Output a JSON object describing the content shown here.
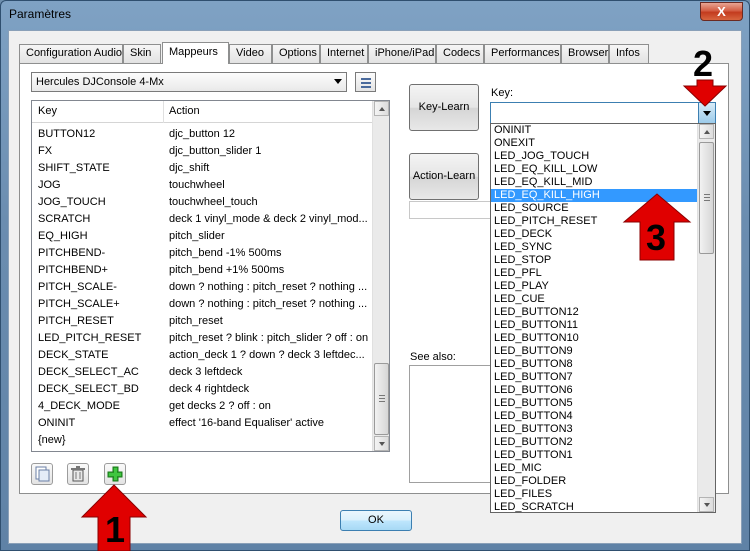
{
  "window": {
    "title": "Paramètres",
    "close_glyph": "X"
  },
  "tabs": [
    {
      "label": "Configuration Audio",
      "active": false
    },
    {
      "label": "Skin",
      "active": false
    },
    {
      "label": "Mappeurs",
      "active": true
    },
    {
      "label": "Video",
      "active": false
    },
    {
      "label": "Options",
      "active": false
    },
    {
      "label": "Internet",
      "active": false
    },
    {
      "label": "iPhone/iPad",
      "active": false
    },
    {
      "label": "Codecs",
      "active": false
    },
    {
      "label": "Performances",
      "active": false
    },
    {
      "label": "Browser",
      "active": false
    },
    {
      "label": "Infos",
      "active": false
    }
  ],
  "device": {
    "selected": "Hercules DJConsole 4-Mx",
    "list_icon": "list-icon"
  },
  "mapping_table": {
    "headers": {
      "key": "Key",
      "action": "Action"
    },
    "rows": [
      {
        "key": "BUTTON12",
        "action": "djc_button 12"
      },
      {
        "key": "FX",
        "action": "djc_button_slider 1"
      },
      {
        "key": "SHIFT_STATE",
        "action": "djc_shift"
      },
      {
        "key": "JOG",
        "action": "touchwheel"
      },
      {
        "key": "JOG_TOUCH",
        "action": "touchwheel_touch"
      },
      {
        "key": "SCRATCH",
        "action": "deck 1 vinyl_mode & deck 2 vinyl_mod..."
      },
      {
        "key": "EQ_HIGH",
        "action": "pitch_slider"
      },
      {
        "key": "PITCHBEND-",
        "action": "pitch_bend -1% 500ms"
      },
      {
        "key": "PITCHBEND+",
        "action": "pitch_bend +1% 500ms"
      },
      {
        "key": "PITCH_SCALE-",
        "action": "down ? nothing : pitch_reset ? nothing ..."
      },
      {
        "key": "PITCH_SCALE+",
        "action": "down ? nothing : pitch_reset ? nothing ..."
      },
      {
        "key": "PITCH_RESET",
        "action": "pitch_reset"
      },
      {
        "key": "LED_PITCH_RESET",
        "action": "pitch_reset ? blink : pitch_slider ? off : on"
      },
      {
        "key": "DECK_STATE",
        "action": "action_deck 1 ? down ? deck 3 leftdec..."
      },
      {
        "key": "DECK_SELECT_AC",
        "action": "deck 3 leftdeck"
      },
      {
        "key": "DECK_SELECT_BD",
        "action": "deck 4 rightdeck"
      },
      {
        "key": "4_DECK_MODE",
        "action": "get decks 2 ? off : on"
      },
      {
        "key": "ONINIT",
        "action": "effect '16-band Equaliser' active"
      },
      {
        "key": "{new}",
        "action": ""
      }
    ]
  },
  "bottom_buttons": {
    "copy_icon": "copy-icon",
    "delete_icon": "trash-icon",
    "add_icon": "plus-icon"
  },
  "right_panel": {
    "key_learn_label": "Key-Learn",
    "action_learn_label": "Action-Learn",
    "key_label": "Key:",
    "key_value": "",
    "see_also_label": "See also:"
  },
  "key_dropdown": {
    "selected": "LED_EQ_KILL_HIGH",
    "items": [
      "ONINIT",
      "ONEXIT",
      "LED_JOG_TOUCH",
      "LED_EQ_KILL_LOW",
      "LED_EQ_KILL_MID",
      "LED_EQ_KILL_HIGH",
      "LED_SOURCE",
      "LED_PITCH_RESET",
      "LED_DECK",
      "LED_SYNC",
      "LED_STOP",
      "LED_PFL",
      "LED_PLAY",
      "LED_CUE",
      "LED_BUTTON12",
      "LED_BUTTON11",
      "LED_BUTTON10",
      "LED_BUTTON9",
      "LED_BUTTON8",
      "LED_BUTTON7",
      "LED_BUTTON6",
      "LED_BUTTON5",
      "LED_BUTTON4",
      "LED_BUTTON3",
      "LED_BUTTON2",
      "LED_BUTTON1",
      "LED_MIC",
      "LED_FOLDER",
      "LED_FILES",
      "LED_SCRATCH"
    ]
  },
  "ok_label": "OK",
  "annotations": [
    {
      "number": "1",
      "color": "#e00000"
    },
    {
      "number": "2",
      "color": "#e00000"
    },
    {
      "number": "3",
      "color": "#e00000"
    }
  ]
}
